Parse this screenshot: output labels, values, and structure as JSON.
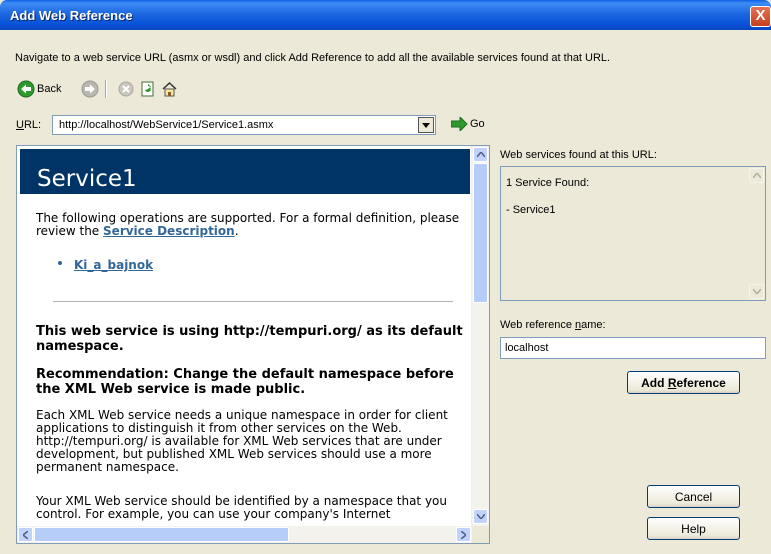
{
  "window": {
    "title": "Add Web Reference",
    "close_label": "X"
  },
  "instruction": "Navigate to a web service URL (asmx or wsdl) and click Add Reference to add all the available services found at that URL.",
  "toolbar": {
    "back_label": "Back",
    "icons": [
      "back-arrow-icon",
      "forward-arrow-icon",
      "stop-icon",
      "refresh-icon",
      "home-icon"
    ]
  },
  "url": {
    "label": "URL:",
    "value": "http://localhost/WebService1/Service1.asmx",
    "go_label": "Go"
  },
  "browser": {
    "service_name": "Service1",
    "intro_text": "The following operations are supported. For a formal definition, please review the",
    "description_link": "Service Description",
    "intro_end": ".",
    "operation": "Ki_a_bajnok",
    "namespace_heading": "This web service is using http://tempuri.org/ as its default namespace.",
    "recommendation_heading": "Recommendation: Change the default namespace before the XML Web service is made public.",
    "para1": "Each XML Web service needs a unique namespace in order for client applications to distinguish it from other services on the Web. http://tempuri.org/ is available for XML Web services that are under development, but published XML Web services should use a more permanent namespace.",
    "para2": "Your XML Web service should be identified by a namespace that you control. For example, you can use your company's Internet"
  },
  "results": {
    "label": "Web services found at this URL:",
    "count_text": "1 Service Found:",
    "items": [
      "- Service1"
    ]
  },
  "reference": {
    "label": "Web reference name:",
    "value": "localhost"
  },
  "buttons": {
    "add_reference": "Add Reference",
    "cancel": "Cancel",
    "help": "Help"
  },
  "colors": {
    "title_bar": "#0a5fe8",
    "banner": "#003366",
    "link": "#336699",
    "dialog_bg": "#ece9d8"
  }
}
